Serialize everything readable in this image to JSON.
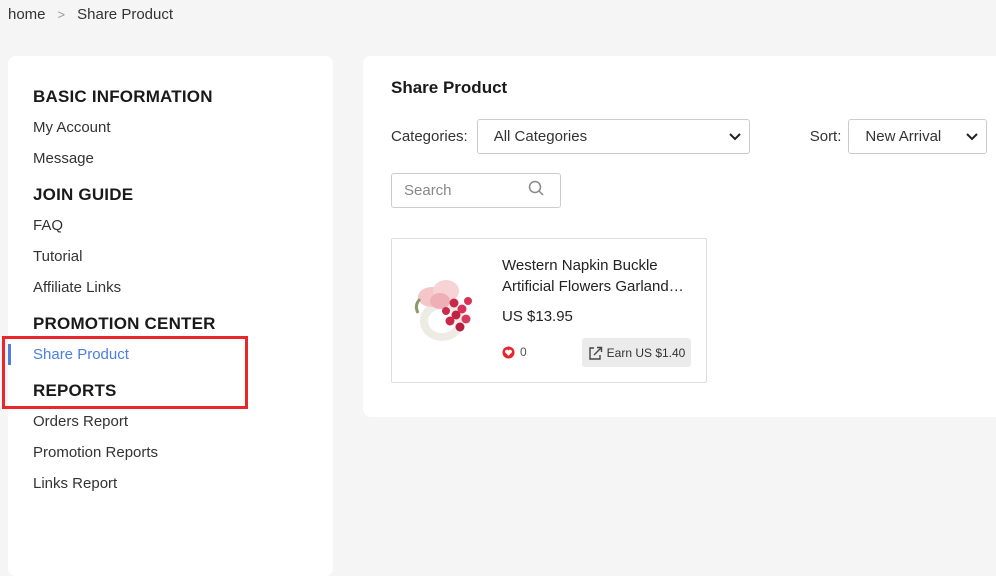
{
  "breadcrumb": {
    "home": "home",
    "current": "Share Product"
  },
  "sidebar": {
    "sections": [
      {
        "title": "BASIC INFORMATION",
        "items": [
          "My Account",
          "Message"
        ]
      },
      {
        "title": "JOIN GUIDE",
        "items": [
          "FAQ",
          "Tutorial",
          "Affiliate Links"
        ]
      },
      {
        "title": "PROMOTION CENTER",
        "items": [
          "Share Product"
        ]
      },
      {
        "title": "REPORTS",
        "items": [
          "Orders Report",
          "Promotion Reports",
          "Links Report"
        ]
      }
    ],
    "active_item": "Share Product"
  },
  "main": {
    "title": "Share Product",
    "categories_label": "Categories:",
    "categories_value": "All Categories",
    "sort_label": "Sort:",
    "sort_value": "New Arrival",
    "search_placeholder": "Search"
  },
  "product": {
    "title_line1": "Western Napkin Buckle",
    "title_line2": "Artificial Flowers Garland…",
    "price": "US $13.95",
    "likes": "0",
    "earn": "Earn US $1.40"
  },
  "colors": {
    "accent": "#4a7fe0",
    "highlight": "#e8262c",
    "heart": "#e8262c"
  }
}
